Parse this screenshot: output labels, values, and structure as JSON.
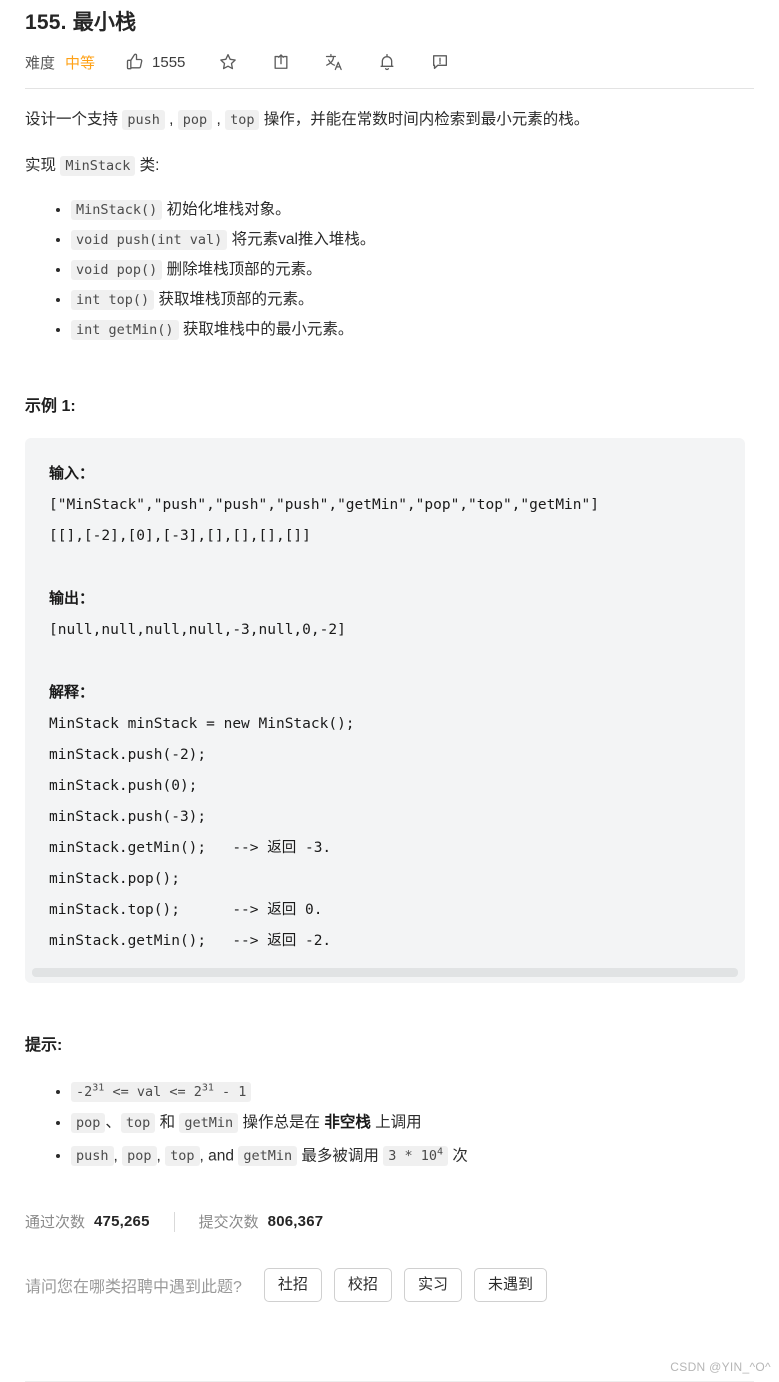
{
  "header": {
    "title": "155. 最小栈",
    "difficulty_label": "难度",
    "difficulty_value": "中等",
    "difficulty_color": "#ffa116",
    "likes": "1555",
    "icons": [
      "thumbs-up-icon",
      "star-icon",
      "share-icon",
      "translate-icon",
      "bell-icon",
      "feedback-icon"
    ]
  },
  "description": {
    "line1_a": "设计一个支持 ",
    "code_push": "push",
    "sep1": " , ",
    "code_pop": "pop",
    "sep2": " , ",
    "code_top": "top",
    "line1_b": " 操作，并能在常数时间内检索到最小元素的栈。",
    "line2_a": "实现 ",
    "code_minstack": "MinStack",
    "line2_b": " 类:"
  },
  "methods": [
    {
      "code": "MinStack()",
      "text": " 初始化堆栈对象。"
    },
    {
      "code": "void push(int val)",
      "text": " 将元素val推入堆栈。"
    },
    {
      "code": "void pop()",
      "text": " 删除堆栈顶部的元素。"
    },
    {
      "code": "int top()",
      "text": " 获取堆栈顶部的元素。"
    },
    {
      "code": "int getMin()",
      "text": " 获取堆栈中的最小元素。"
    }
  ],
  "example": {
    "heading": "示例 1:",
    "input_label": "输入：",
    "input_line1": "[\"MinStack\",\"push\",\"push\",\"push\",\"getMin\",\"pop\",\"top\",\"getMin\"]",
    "input_line2": "[[],[-2],[0],[-3],[],[],[],[]]",
    "output_label": "输出：",
    "output_line": "[null,null,null,null,-3,null,0,-2]",
    "explain_label": "解释：",
    "explain_lines": [
      "MinStack minStack = new MinStack();",
      "minStack.push(-2);",
      "minStack.push(0);",
      "minStack.push(-3);",
      "minStack.getMin();   --> 返回 -3.",
      "minStack.pop();",
      "minStack.top();      --> 返回 0.",
      "minStack.getMin();   --> 返回 -2."
    ]
  },
  "hints": {
    "heading": "提示:",
    "item1": {
      "c_neg": "-2",
      "c_sup1": "31",
      "c_mid": "  <= val <= 2",
      "c_sup2": "31",
      "c_end": "  - 1"
    },
    "item2": {
      "c_pop": "pop",
      "t1": "、",
      "c_top": "top",
      "t2": " 和 ",
      "c_getmin": "getMin",
      "t3": " 操作总是在 ",
      "bold": "非空栈",
      "t4": " 上调用"
    },
    "item3": {
      "c_push": "push",
      "t1": ", ",
      "c_pop": "pop",
      "t2": ", ",
      "c_top": "top",
      "t3": ", and ",
      "c_getmin": "getMin",
      "t4": " 最多被调用 ",
      "c_num": "3 * 10",
      "c_sup": "4",
      "t5": " 次"
    }
  },
  "stats": {
    "accepted_label": "通过次数",
    "accepted_value": "475,265",
    "submissions_label": "提交次数",
    "submissions_value": "806,367"
  },
  "poll": {
    "question": "请问您在哪类招聘中遇到此题?",
    "options": [
      "社招",
      "校招",
      "实习",
      "未遇到"
    ]
  },
  "watermark": "CSDN @YIN_^O^"
}
